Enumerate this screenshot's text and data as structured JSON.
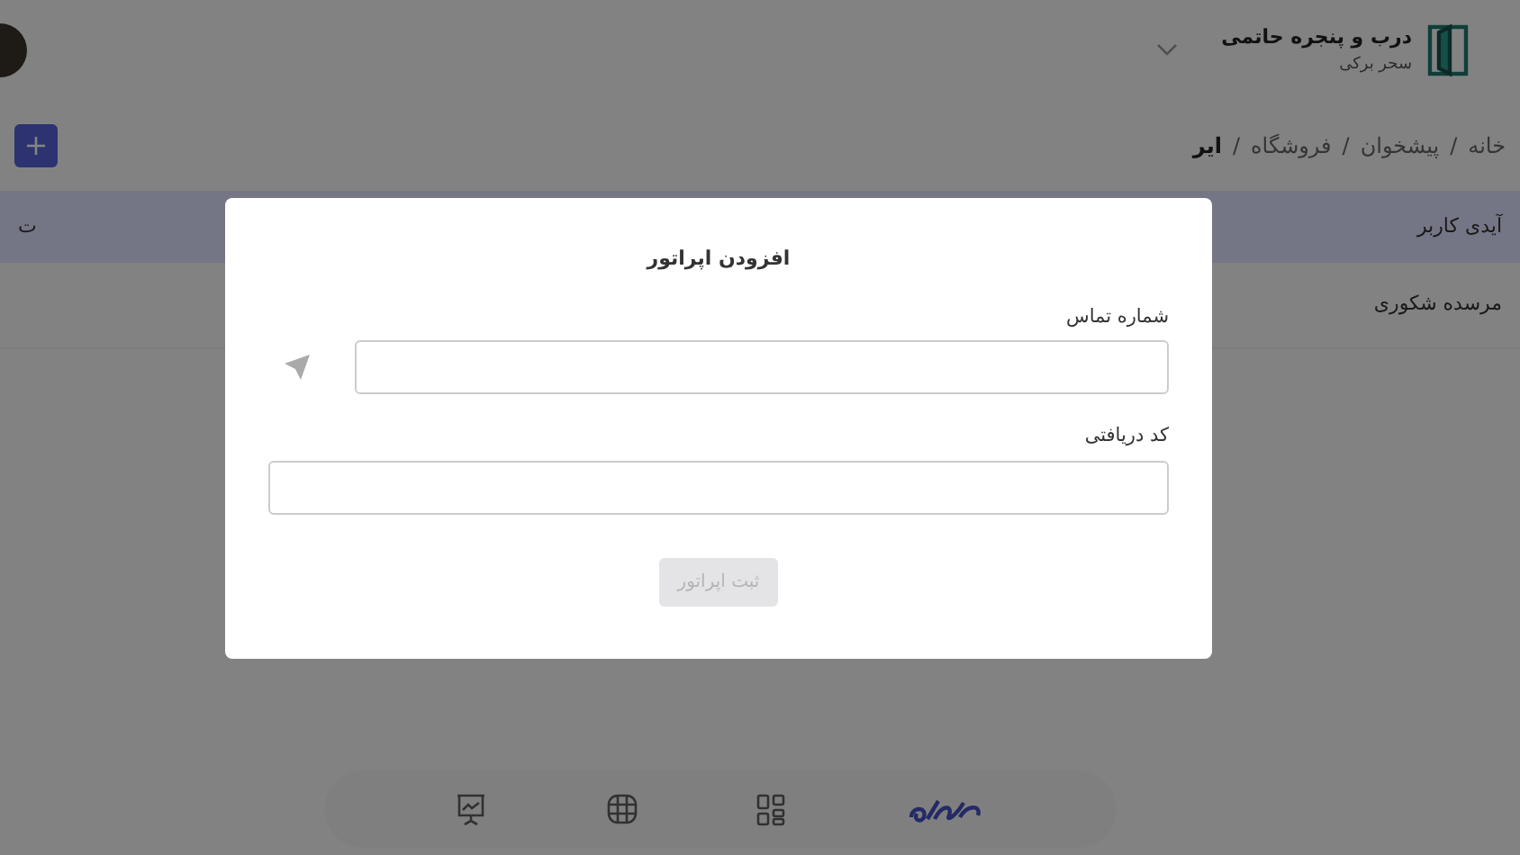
{
  "header": {
    "brand": "درب و پنجره حاتمی",
    "subtitle": "سحر برکی"
  },
  "breadcrumb": {
    "separator": "/",
    "items": [
      {
        "label": "خانه",
        "selected": false
      },
      {
        "label": "پیشخوان",
        "selected": false
      },
      {
        "label": "فروشگاه",
        "selected": false
      },
      {
        "label": "ایر",
        "selected": true
      }
    ]
  },
  "table": {
    "columns": [
      "آیدی کاربر",
      "ت"
    ],
    "rows": [
      [
        "مرسده شکوری"
      ]
    ]
  },
  "modal": {
    "title": "افزودن اپراتور",
    "fields": [
      {
        "label": "شماره تماس",
        "kind": "send"
      },
      {
        "label": "کد دریافتی",
        "kind": "plain"
      }
    ],
    "submit": {
      "label": "ثبت اپراتور",
      "disabled": true
    }
  },
  "bottom_nav": [
    {
      "kind": "logo",
      "selected": true
    },
    {
      "kind": "apps",
      "selected": false
    },
    {
      "kind": "grid",
      "selected": false
    },
    {
      "kind": "board",
      "selected": false
    }
  ]
}
